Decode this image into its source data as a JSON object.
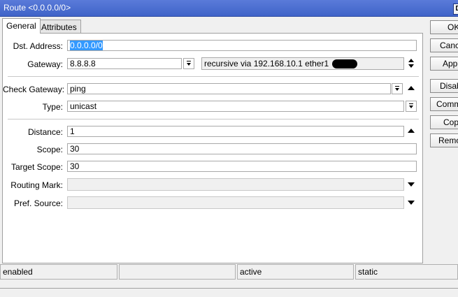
{
  "window": {
    "title": "Route <0.0.0.0/0>",
    "title_button": "D"
  },
  "tabs": [
    {
      "label": "General"
    },
    {
      "label": "Attributes"
    }
  ],
  "fields": {
    "dst_address": {
      "label": "Dst. Address:",
      "value": "0.0.0.0/0"
    },
    "gateway": {
      "label": "Gateway:",
      "value": "8.8.8.8",
      "status": "recursive via 192.168.10.1 ether1"
    },
    "check_gateway": {
      "label": "Check Gateway:",
      "value": "ping"
    },
    "type": {
      "label": "Type:",
      "value": "unicast"
    },
    "distance": {
      "label": "Distance:",
      "value": "1"
    },
    "scope": {
      "label": "Scope:",
      "value": "30"
    },
    "target_scope": {
      "label": "Target Scope:",
      "value": "30"
    },
    "routing_mark": {
      "label": "Routing Mark:",
      "value": ""
    },
    "pref_source": {
      "label": "Pref. Source:",
      "value": ""
    }
  },
  "buttons": [
    "OK",
    "Cancel",
    "Apply",
    "Disable",
    "Comment",
    "Copy",
    "Remove"
  ],
  "status": [
    "enabled",
    "",
    "active",
    "static"
  ],
  "colors": {
    "titlebar": "#3f63c8",
    "selection": "#3399ff"
  }
}
